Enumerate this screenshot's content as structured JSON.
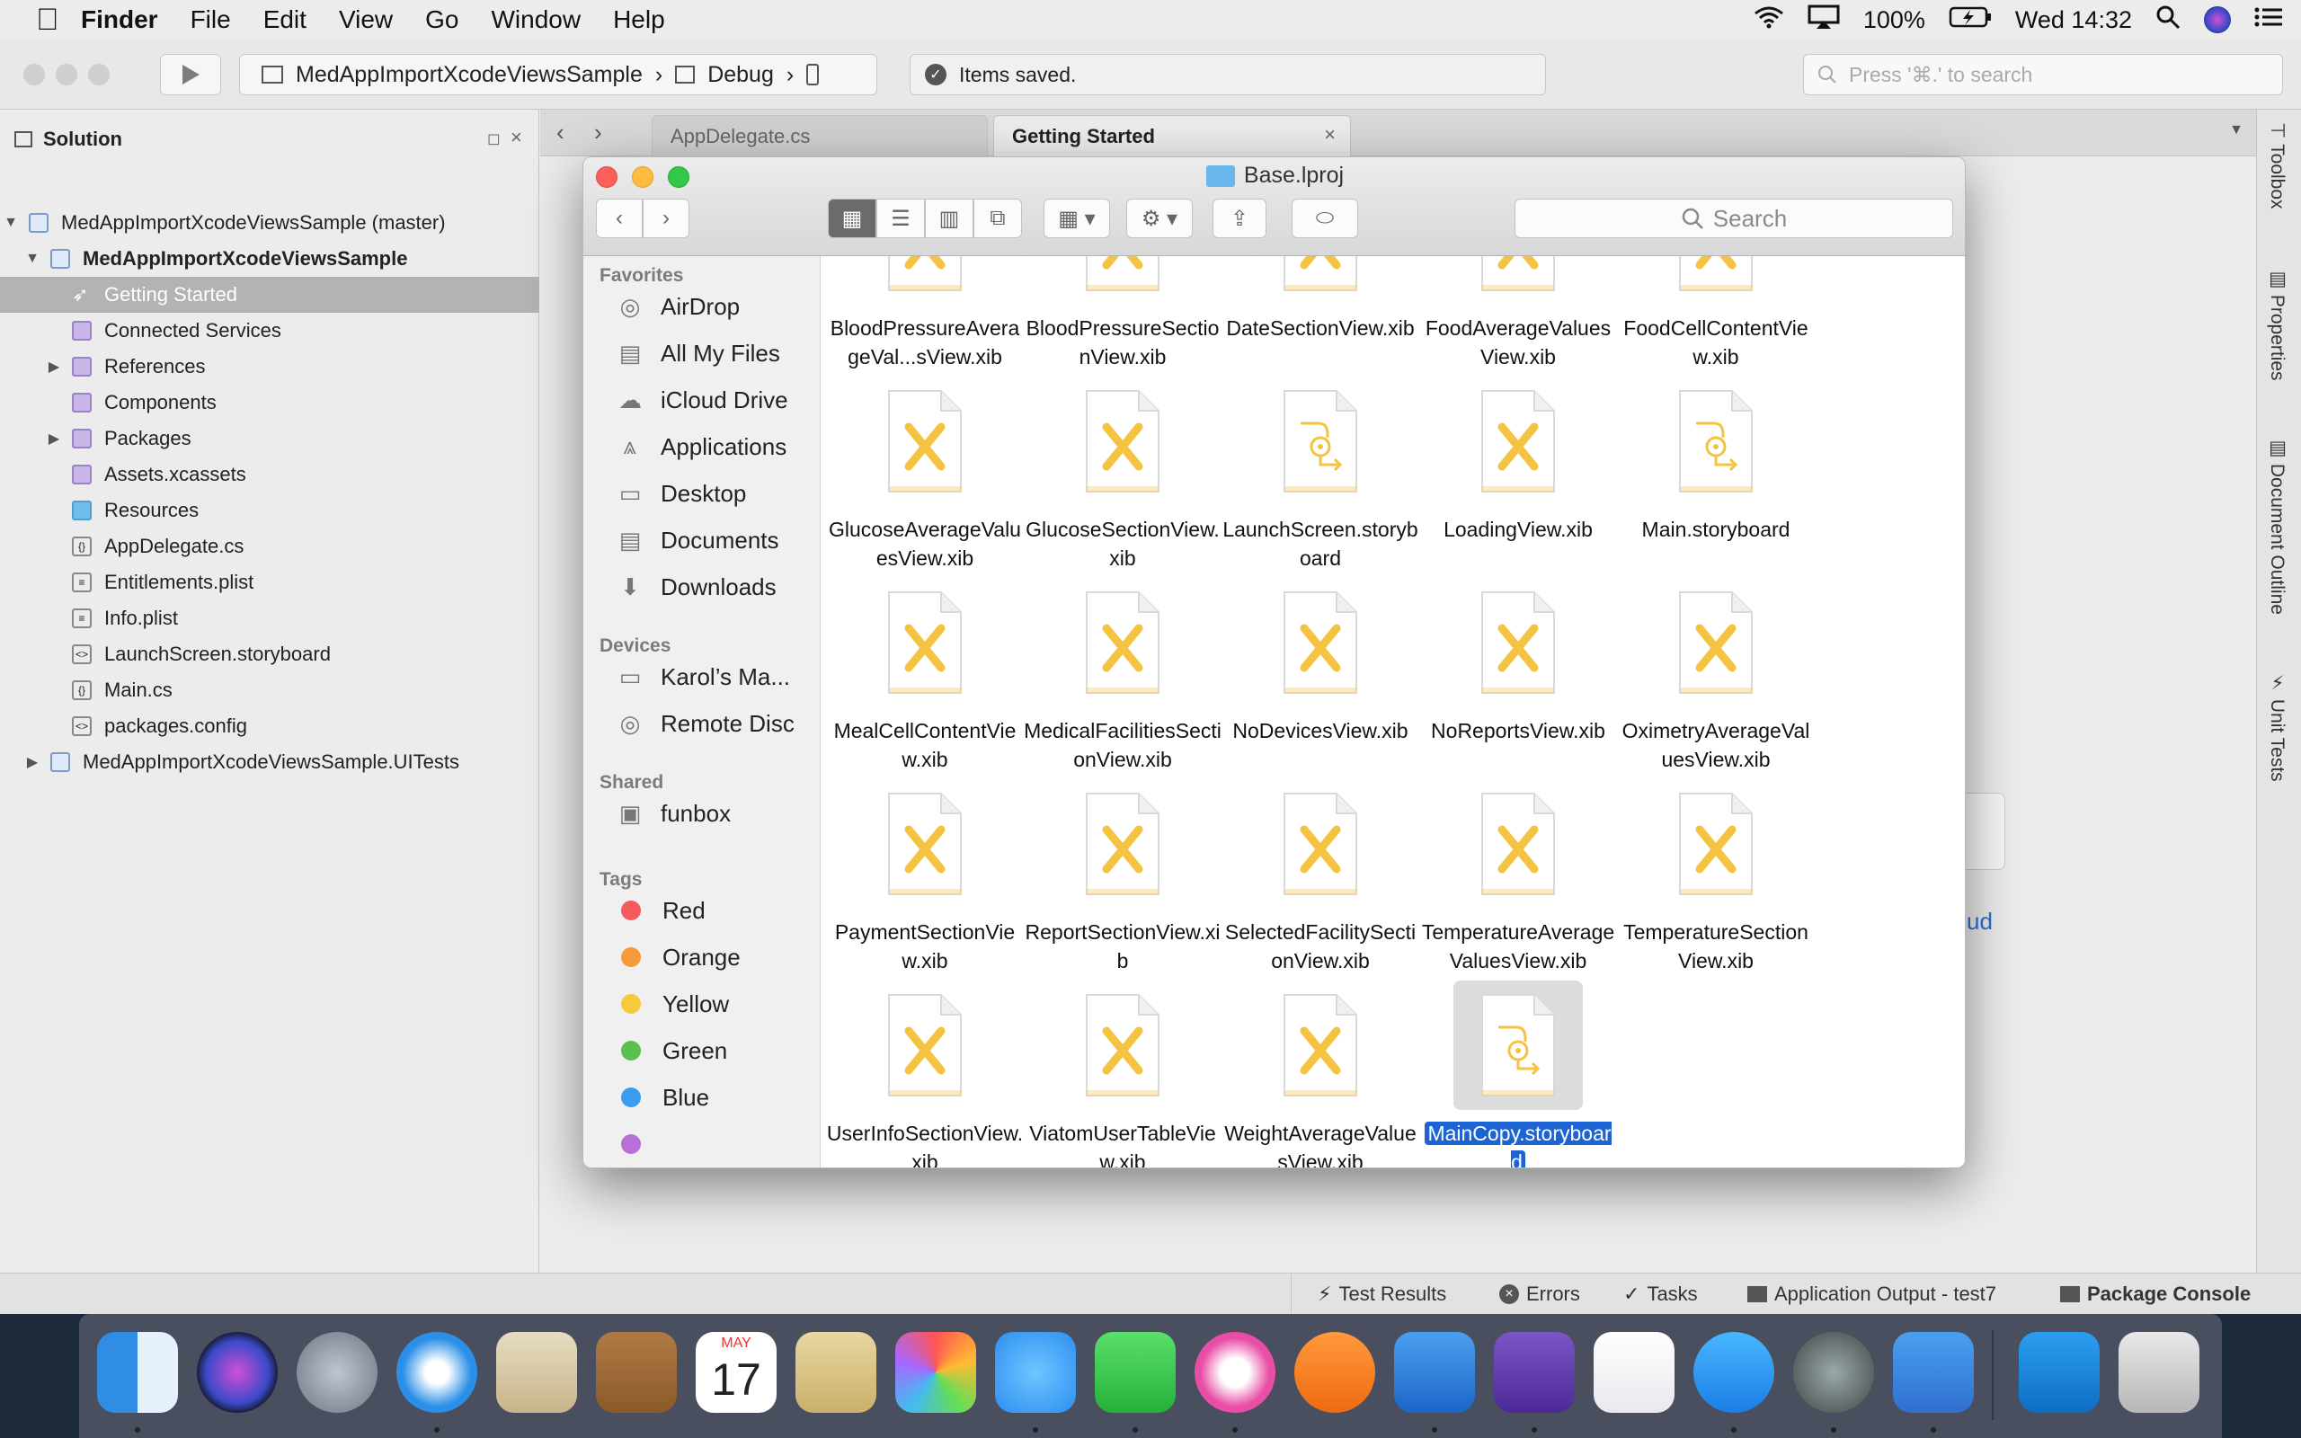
{
  "menubar": {
    "app": "Finder",
    "items": [
      "File",
      "Edit",
      "View",
      "Go",
      "Window",
      "Help"
    ],
    "battery": "100%",
    "clock": "Wed 14:32"
  },
  "toolbar": {
    "breadcrumb_project": "MedAppImportXcodeViewsSample",
    "breadcrumb_config": "Debug",
    "status": "Items saved.",
    "search_placeholder": "Press '⌘.' to search"
  },
  "solution": {
    "title": "Solution",
    "rows": [
      {
        "label": "MedAppImportXcodeViewsSample (master)"
      },
      {
        "label": "MedAppImportXcodeViewsSample"
      },
      {
        "label": "Getting Started"
      },
      {
        "label": "Connected Services"
      },
      {
        "label": "References"
      },
      {
        "label": "Components"
      },
      {
        "label": "Packages"
      },
      {
        "label": "Assets.xcassets"
      },
      {
        "label": "Resources"
      },
      {
        "label": "AppDelegate.cs"
      },
      {
        "label": "Entitlements.plist"
      },
      {
        "label": "Info.plist"
      },
      {
        "label": "LaunchScreen.storyboard"
      },
      {
        "label": "Main.cs"
      },
      {
        "label": "packages.config"
      },
      {
        "label": "MedAppImportXcodeViewsSample.UITests"
      }
    ]
  },
  "editor": {
    "tabs": [
      "AppDelegate.cs",
      "Getting Started"
    ],
    "behind_text": "ud"
  },
  "rightbar": [
    "Toolbox",
    "Properties",
    "Document Outline",
    "Unit Tests"
  ],
  "statusbar": [
    "Test Results",
    "Errors",
    "Tasks",
    "Application Output - test7",
    "Package Console"
  ],
  "finder": {
    "title": "Base.lproj",
    "search_placeholder": "Search",
    "sidebar": {
      "favorites_head": "Favorites",
      "favorites": [
        "AirDrop",
        "All My Files",
        "iCloud Drive",
        "Applications",
        "Desktop",
        "Documents",
        "Downloads"
      ],
      "devices_head": "Devices",
      "devices": [
        "Karol’s Ma...",
        "Remote Disc"
      ],
      "shared_head": "Shared",
      "shared": [
        "funbox"
      ],
      "tags_head": "Tags",
      "tags": [
        "Red",
        "Orange",
        "Yellow",
        "Green",
        "Blue"
      ],
      "tag_colors": [
        "#f45c5c",
        "#f69a3a",
        "#f5cb3c",
        "#5ac04e",
        "#3a9cf0"
      ]
    },
    "files": [
      {
        "name": "BloodPressureAverageVal...sView.xib",
        "kind": "xib"
      },
      {
        "name": "BloodPressureSectionView.xib",
        "kind": "xib"
      },
      {
        "name": "DateSectionView.xib",
        "kind": "xib"
      },
      {
        "name": "FoodAverageValuesView.xib",
        "kind": "xib"
      },
      {
        "name": "FoodCellContentView.xib",
        "kind": "xib"
      },
      {
        "name": "GlucoseAverageValuesView.xib",
        "kind": "xib"
      },
      {
        "name": "GlucoseSectionView.xib",
        "kind": "xib"
      },
      {
        "name": "LaunchScreen.storyboard",
        "kind": "storyboard"
      },
      {
        "name": "LoadingView.xib",
        "kind": "xib"
      },
      {
        "name": "Main.storyboard",
        "kind": "storyboard"
      },
      {
        "name": "MealCellContentView.xib",
        "kind": "xib"
      },
      {
        "name": "MedicalFacilitiesSectionView.xib",
        "kind": "xib"
      },
      {
        "name": "NoDevicesView.xib",
        "kind": "xib"
      },
      {
        "name": "NoReportsView.xib",
        "kind": "xib"
      },
      {
        "name": "OximetryAverageValuesView.xib",
        "kind": "xib"
      },
      {
        "name": "PaymentSectionView.xib",
        "kind": "xib"
      },
      {
        "name": "ReportSectionView.xib",
        "kind": "xib"
      },
      {
        "name": "SelectedFacilitySectionView.xib",
        "kind": "xib"
      },
      {
        "name": "TemperatureAverageValuesView.xib",
        "kind": "xib"
      },
      {
        "name": "TemperatureSectionView.xib",
        "kind": "xib"
      },
      {
        "name": "UserInfoSectionView.xib",
        "kind": "xib"
      },
      {
        "name": "ViatomUserTableView.xib",
        "kind": "xib"
      },
      {
        "name": "WeightAverageValuesView.xib",
        "kind": "xib"
      },
      {
        "name": "MainCopy.storyboard",
        "kind": "storyboard",
        "selected": true
      }
    ]
  },
  "dock": {
    "apps": [
      "finder-icon",
      "siri-icon",
      "launchpad-icon",
      "safari-icon",
      "mail-icon",
      "contacts-icon",
      "calendar-icon",
      "preview-icon",
      "photos-icon",
      "messages-icon",
      "facetime-icon",
      "itunes-icon",
      "ibooks-icon",
      "xcode-icon",
      "visual-studio-icon",
      "xamarin-icon",
      "app-store-icon",
      "system-preferences-icon",
      "simulator-icon",
      "vscode-icon",
      "trash-icon"
    ],
    "calendar_month": "MAY",
    "calendar_day": "17"
  },
  "colors": {
    "accent": "#1c63d3",
    "xib_yellow": "#f5c342"
  }
}
